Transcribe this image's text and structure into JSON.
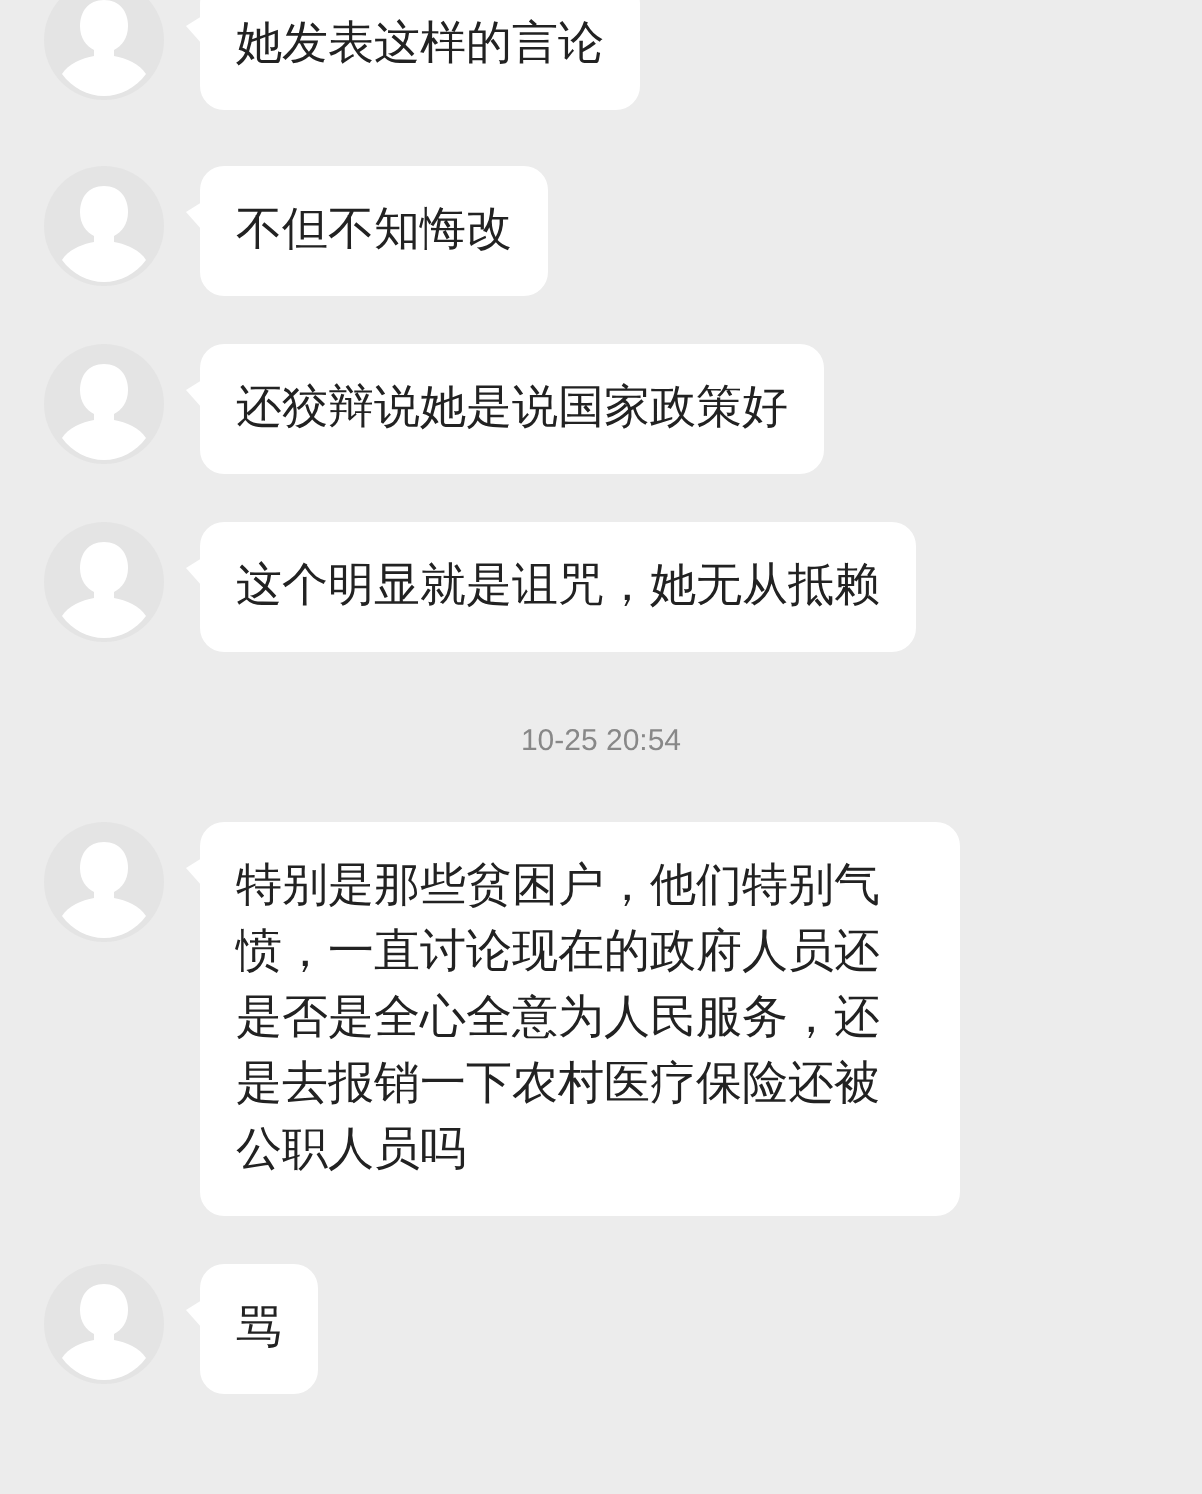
{
  "chat": [
    {
      "kind": "message",
      "text": "她发表这样的言论"
    },
    {
      "kind": "message",
      "text": "不但不知悔改"
    },
    {
      "kind": "message",
      "text": "还狡辩说她是说国家政策好"
    },
    {
      "kind": "message",
      "text": "这个明显就是诅咒，她无从抵赖"
    },
    {
      "kind": "timestamp",
      "text": "10-25 20:54"
    },
    {
      "kind": "message",
      "text": "特别是那些贫困户，他们特别气愤，一直讨论现在的政府人员还是否是全心全意为人民服务，还是去报销一下农村医疗保险还被公职人员吗"
    },
    {
      "kind": "message",
      "text": "骂"
    }
  ]
}
